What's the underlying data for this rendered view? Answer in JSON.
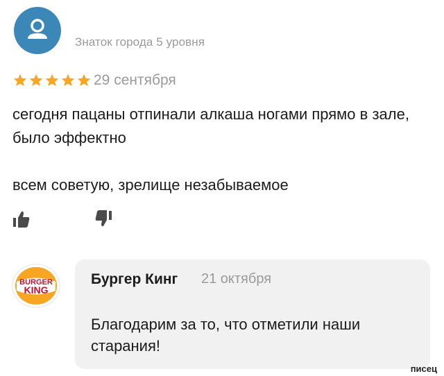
{
  "review": {
    "author_level": "Знаток города 5 уровня",
    "rating": 5,
    "rating_max": 5,
    "date": "29 сентября",
    "text_line1": "сегодня пацаны отпинали алкаша ногами прямо в зале, было эффектно",
    "text_line2": "всем советую, зрелище незабываемое",
    "like_icon": "thumbs-up-icon",
    "dislike_icon": "thumbs-down-icon"
  },
  "reply": {
    "logo_line1": "BURGER",
    "logo_line2": "KING",
    "author": "Бургер Кинг",
    "date": "21 октября",
    "text": "Благодарим за то, что отметили наши старания!"
  },
  "watermark": "писец",
  "colors": {
    "avatar": "#3b87b8",
    "star": "#f5a623",
    "muted_text": "#9a9a9a",
    "bubble": "#f1f1f1"
  }
}
